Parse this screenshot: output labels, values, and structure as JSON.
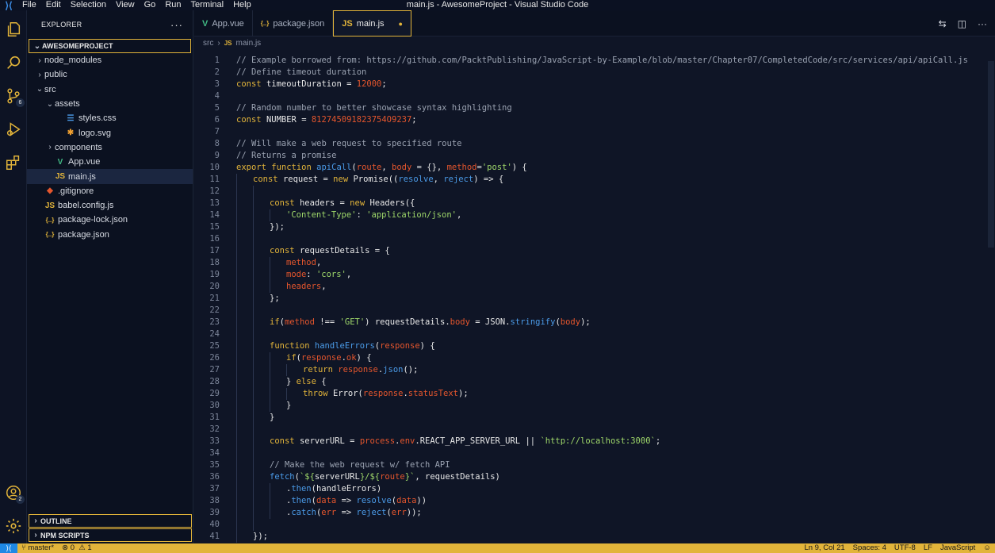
{
  "titlebar": {
    "menu": [
      "File",
      "Edit",
      "Selection",
      "View",
      "Go",
      "Run",
      "Terminal",
      "Help"
    ],
    "title": "main.js - AwesomeProject - Visual Studio Code"
  },
  "activitybar": {
    "source_control_badge": "6",
    "accounts_badge": "2"
  },
  "sidebar": {
    "header": "EXPLORER",
    "more": "···",
    "project": "AWESOMEPROJECT",
    "outline": "OUTLINE",
    "npm_scripts": "NPM SCRIPTS",
    "tree": [
      {
        "label": "node_modules",
        "kind": "folder",
        "open": false,
        "depth": 0,
        "icon": "",
        "icon_class": ""
      },
      {
        "label": "public",
        "kind": "folder",
        "open": false,
        "depth": 0,
        "icon": "",
        "icon_class": ""
      },
      {
        "label": "src",
        "kind": "folder",
        "open": true,
        "depth": 0,
        "icon": "",
        "icon_class": ""
      },
      {
        "label": "assets",
        "kind": "folder",
        "open": true,
        "depth": 1,
        "icon": "",
        "icon_class": ""
      },
      {
        "label": "styles.css",
        "kind": "file",
        "depth": 2,
        "icon": "☰",
        "icon_class": "ic-css"
      },
      {
        "label": "logo.svg",
        "kind": "file",
        "depth": 2,
        "icon": "✱",
        "icon_class": "ic-svg"
      },
      {
        "label": "components",
        "kind": "folder",
        "open": false,
        "depth": 1,
        "icon": "",
        "icon_class": ""
      },
      {
        "label": "App.vue",
        "kind": "file",
        "depth": 1,
        "icon": "V",
        "icon_class": "ic-vue"
      },
      {
        "label": "main.js",
        "kind": "file",
        "depth": 1,
        "icon": "JS",
        "icon_class": "ic-js",
        "active": true
      },
      {
        "label": ".gitignore",
        "kind": "file",
        "depth": 0,
        "icon": "◆",
        "icon_class": "ic-git"
      },
      {
        "label": "babel.config.js",
        "kind": "file",
        "depth": 0,
        "icon": "JS",
        "icon_class": "ic-js"
      },
      {
        "label": "package-lock.json",
        "kind": "file",
        "depth": 0,
        "icon": "{..}",
        "icon_class": "ic-json"
      },
      {
        "label": "package.json",
        "kind": "file",
        "depth": 0,
        "icon": "{..}",
        "icon_class": "ic-json"
      }
    ]
  },
  "editor": {
    "tabs": [
      {
        "label": "App.vue",
        "icon": "V",
        "icon_class": "ic-vue",
        "active": false,
        "dirty": false
      },
      {
        "label": "package.json",
        "icon": "{..}",
        "icon_class": "ic-json",
        "active": false,
        "dirty": false
      },
      {
        "label": "main.js",
        "icon": "JS",
        "icon_class": "ic-js",
        "active": true,
        "dirty": true
      }
    ],
    "breadcrumb": [
      "src",
      "main.js"
    ],
    "code_lines": [
      {
        "g": 0,
        "t": [
          [
            "cm",
            "// Example borrowed from: https://github.com/PacktPublishing/JavaScript-by-Example/blob/master/Chapter07/CompletedCode/src/services/api/apiCall.js"
          ]
        ]
      },
      {
        "g": 0,
        "t": [
          [
            "cm",
            "// Define timeout duration"
          ]
        ]
      },
      {
        "g": 0,
        "t": [
          [
            "kw",
            "const "
          ],
          [
            "id",
            "timeoutDuration "
          ],
          [
            "pu",
            "= "
          ],
          [
            "num",
            "12000"
          ],
          [
            "pu",
            ";"
          ]
        ]
      },
      {
        "g": 0,
        "t": []
      },
      {
        "g": 0,
        "t": [
          [
            "cm",
            "// Random number to better showcase syntax highlighting"
          ]
        ]
      },
      {
        "g": 0,
        "t": [
          [
            "kw",
            "const "
          ],
          [
            "id",
            "NUMBER "
          ],
          [
            "pu",
            "= "
          ],
          [
            "num",
            "812745091823754O9237"
          ],
          [
            "pu",
            ";"
          ]
        ]
      },
      {
        "g": 0,
        "t": []
      },
      {
        "g": 0,
        "t": [
          [
            "cm",
            "// Will make a web request to specified route"
          ]
        ]
      },
      {
        "g": 0,
        "t": [
          [
            "cm",
            "// Returns a promise"
          ]
        ]
      },
      {
        "g": 0,
        "t": [
          [
            "kw",
            "export function "
          ],
          [
            "fn",
            "apiCall"
          ],
          [
            "pu",
            "("
          ],
          [
            "par",
            "route"
          ],
          [
            "pu",
            ", "
          ],
          [
            "par",
            "body"
          ],
          [
            "pu",
            " = {}, "
          ],
          [
            "par",
            "method"
          ],
          [
            "pu",
            "="
          ],
          [
            "str",
            "'post'"
          ],
          [
            "pu",
            ") {"
          ]
        ]
      },
      {
        "g": 1,
        "t": [
          [
            "kw",
            "const "
          ],
          [
            "id",
            "request "
          ],
          [
            "pu",
            "= "
          ],
          [
            "kw",
            "new "
          ],
          [
            "id",
            "Promise"
          ],
          [
            "pu",
            "(("
          ],
          [
            "fn",
            "resolve"
          ],
          [
            "pu",
            ", "
          ],
          [
            "fn",
            "reject"
          ],
          [
            "pu",
            ") => {"
          ]
        ]
      },
      {
        "g": 2,
        "t": []
      },
      {
        "g": 2,
        "t": [
          [
            "kw",
            "const "
          ],
          [
            "id",
            "headers "
          ],
          [
            "pu",
            "= "
          ],
          [
            "kw",
            "new "
          ],
          [
            "id",
            "Headers"
          ],
          [
            "pu",
            "({"
          ]
        ]
      },
      {
        "g": 3,
        "t": [
          [
            "str",
            "'Content-Type'"
          ],
          [
            "pu",
            ": "
          ],
          [
            "str",
            "'application/json'"
          ],
          [
            "pu",
            ","
          ]
        ]
      },
      {
        "g": 2,
        "t": [
          [
            "pu",
            "});"
          ]
        ]
      },
      {
        "g": 2,
        "t": []
      },
      {
        "g": 2,
        "t": [
          [
            "kw",
            "const "
          ],
          [
            "id",
            "requestDetails "
          ],
          [
            "pu",
            "= {"
          ]
        ]
      },
      {
        "g": 3,
        "t": [
          [
            "par",
            "method"
          ],
          [
            "pu",
            ","
          ]
        ]
      },
      {
        "g": 3,
        "t": [
          [
            "par",
            "mode"
          ],
          [
            "pu",
            ": "
          ],
          [
            "str",
            "'cors'"
          ],
          [
            "pu",
            ","
          ]
        ]
      },
      {
        "g": 3,
        "t": [
          [
            "par",
            "headers"
          ],
          [
            "pu",
            ","
          ]
        ]
      },
      {
        "g": 2,
        "t": [
          [
            "pu",
            "};"
          ]
        ]
      },
      {
        "g": 2,
        "t": []
      },
      {
        "g": 2,
        "t": [
          [
            "kw",
            "if"
          ],
          [
            "pu",
            "("
          ],
          [
            "par",
            "method "
          ],
          [
            "pu",
            "!== "
          ],
          [
            "str",
            "'GET'"
          ],
          [
            "pu",
            ") "
          ],
          [
            "id",
            "requestDetails"
          ],
          [
            "pu",
            "."
          ],
          [
            "par",
            "body "
          ],
          [
            "pu",
            "= "
          ],
          [
            "id",
            "JSON"
          ],
          [
            "pu",
            "."
          ],
          [
            "fn",
            "stringify"
          ],
          [
            "pu",
            "("
          ],
          [
            "par",
            "body"
          ],
          [
            "pu",
            ");"
          ]
        ]
      },
      {
        "g": 2,
        "t": []
      },
      {
        "g": 2,
        "t": [
          [
            "kw",
            "function "
          ],
          [
            "fn",
            "handleErrors"
          ],
          [
            "pu",
            "("
          ],
          [
            "par",
            "response"
          ],
          [
            "pu",
            ") {"
          ]
        ]
      },
      {
        "g": 3,
        "t": [
          [
            "kw",
            "if"
          ],
          [
            "pu",
            "("
          ],
          [
            "par",
            "response"
          ],
          [
            "pu",
            "."
          ],
          [
            "par",
            "ok"
          ],
          [
            "pu",
            ") {"
          ]
        ]
      },
      {
        "g": 4,
        "t": [
          [
            "kw",
            "return "
          ],
          [
            "par",
            "response"
          ],
          [
            "pu",
            "."
          ],
          [
            "fn",
            "json"
          ],
          [
            "pu",
            "();"
          ]
        ]
      },
      {
        "g": 3,
        "t": [
          [
            "pu",
            "} "
          ],
          [
            "kw",
            "else "
          ],
          [
            "pu",
            "{"
          ]
        ]
      },
      {
        "g": 4,
        "t": [
          [
            "kw",
            "throw "
          ],
          [
            "id",
            "Error"
          ],
          [
            "pu",
            "("
          ],
          [
            "par",
            "response"
          ],
          [
            "pu",
            "."
          ],
          [
            "par",
            "statusText"
          ],
          [
            "pu",
            ");"
          ]
        ]
      },
      {
        "g": 3,
        "t": [
          [
            "pu",
            "}"
          ]
        ]
      },
      {
        "g": 2,
        "t": [
          [
            "pu",
            "}"
          ]
        ]
      },
      {
        "g": 2,
        "t": []
      },
      {
        "g": 2,
        "t": [
          [
            "kw",
            "const "
          ],
          [
            "id",
            "serverURL "
          ],
          [
            "pu",
            "= "
          ],
          [
            "par",
            "process"
          ],
          [
            "pu",
            "."
          ],
          [
            "par",
            "env"
          ],
          [
            "pu",
            "."
          ],
          [
            "id",
            "REACT_APP_SERVER_URL "
          ],
          [
            "pu",
            "|| "
          ],
          [
            "str",
            "`http://localhost:3000`"
          ],
          [
            "pu",
            ";"
          ]
        ]
      },
      {
        "g": 2,
        "t": []
      },
      {
        "g": 2,
        "t": [
          [
            "cm",
            "// Make the web request w/ fetch API"
          ]
        ]
      },
      {
        "g": 2,
        "t": [
          [
            "fn",
            "fetch"
          ],
          [
            "pu",
            "("
          ],
          [
            "str",
            "`${"
          ],
          [
            "id",
            "serverURL"
          ],
          [
            "str",
            "}/${"
          ],
          [
            "par",
            "route"
          ],
          [
            "str",
            "}`"
          ],
          [
            "pu",
            ", "
          ],
          [
            "id",
            "requestDetails"
          ],
          [
            "pu",
            ")"
          ]
        ]
      },
      {
        "g": 3,
        "t": [
          [
            "pu",
            "."
          ],
          [
            "fn",
            "then"
          ],
          [
            "pu",
            "("
          ],
          [
            "id",
            "handleErrors"
          ],
          [
            "pu",
            ")"
          ]
        ]
      },
      {
        "g": 3,
        "t": [
          [
            "pu",
            "."
          ],
          [
            "fn",
            "then"
          ],
          [
            "pu",
            "("
          ],
          [
            "par",
            "data "
          ],
          [
            "pu",
            "=> "
          ],
          [
            "fn",
            "resolve"
          ],
          [
            "pu",
            "("
          ],
          [
            "par",
            "data"
          ],
          [
            "pu",
            "))"
          ]
        ]
      },
      {
        "g": 3,
        "t": [
          [
            "pu",
            "."
          ],
          [
            "fn",
            "catch"
          ],
          [
            "pu",
            "("
          ],
          [
            "par",
            "err "
          ],
          [
            "pu",
            "=> "
          ],
          [
            "fn",
            "reject"
          ],
          [
            "pu",
            "("
          ],
          [
            "par",
            "err"
          ],
          [
            "pu",
            "));"
          ]
        ]
      },
      {
        "g": 2,
        "t": []
      },
      {
        "g": 1,
        "t": [
          [
            "pu",
            "});"
          ]
        ]
      }
    ]
  },
  "statusbar": {
    "branch": "master*",
    "errors": "0",
    "warnings": "1",
    "position": "Ln 9, Col 21",
    "spaces": "Spaces: 4",
    "encoding": "UTF-8",
    "eol": "LF",
    "language": "JavaScript"
  }
}
